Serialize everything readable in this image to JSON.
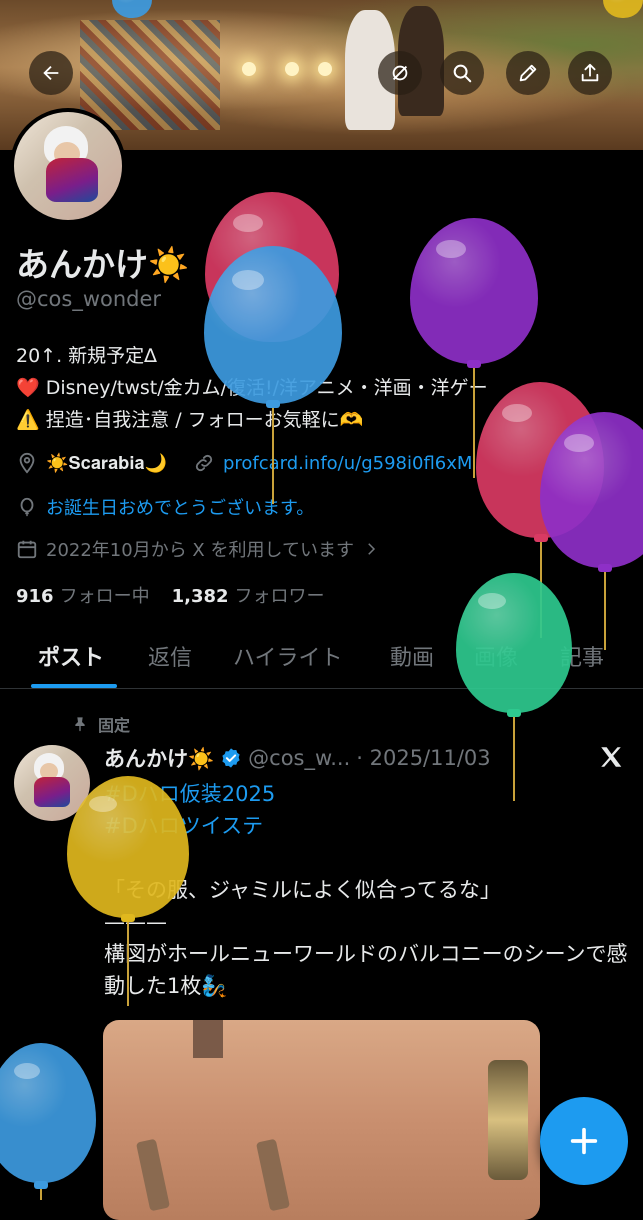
{
  "colors": {
    "accent": "#1d9bf0",
    "text": "#e7e9ea",
    "dim": "#71767b",
    "background": "#000000"
  },
  "header": {
    "icons": [
      "back-arrow-icon",
      "hide-spaces-icon",
      "search-icon",
      "edit-pen-icon",
      "share-icon"
    ]
  },
  "profile": {
    "display_name": "あんかけ☀️",
    "handle": "@cos_wonder",
    "bio_lines": [
      "20↑. 新規予定∆",
      "❤️ Disney/twst/金カム/復活!/洋アニメ・洋画・洋ゲー",
      "⚠️ 捏造･自我注意 / フォローお気軽に🫶"
    ],
    "location": "☀️𝐒𝐜𝐚𝐫𝐚𝐛𝐢𝐚🌙",
    "website": "profcard.info/u/g598i0fl6xM",
    "birthday": "お誕生日おめでとうございます。",
    "joined": "2022年10月から X を利用しています"
  },
  "stats": {
    "following_count": "916",
    "following_label": "フォロー中",
    "followers_count": "1,382",
    "followers_label": "フォロワー"
  },
  "tabs": [
    "ポスト",
    "返信",
    "ハイライト",
    "動画",
    "画像",
    "記事"
  ],
  "active_tab": "ポスト",
  "pinned_post": {
    "pinned_label": "固定",
    "author_name": "あんかけ☀️",
    "verified": true,
    "handle": "@cos_w...",
    "date": "· 2025/11/03",
    "hashtags": [
      "#Dハロ仮装2025",
      "#Dハロツイステ"
    ],
    "lines": [
      "",
      "「その服、ジャミルによく似合ってるな」",
      "———",
      "構図がホールニューワールドのバルコニーのシーンで感動した1枚🧞"
    ]
  },
  "fab": {
    "icon": "plus-icon"
  },
  "balloons": [
    {
      "color": "#d93a63"
    },
    {
      "color": "#3d9be0"
    },
    {
      "color": "#8e2fc7"
    },
    {
      "color": "#d93a63"
    },
    {
      "color": "#8e2fc7"
    },
    {
      "color": "#2ec98f"
    },
    {
      "color": "#e0b81e"
    },
    {
      "color": "#3d9be0"
    }
  ]
}
